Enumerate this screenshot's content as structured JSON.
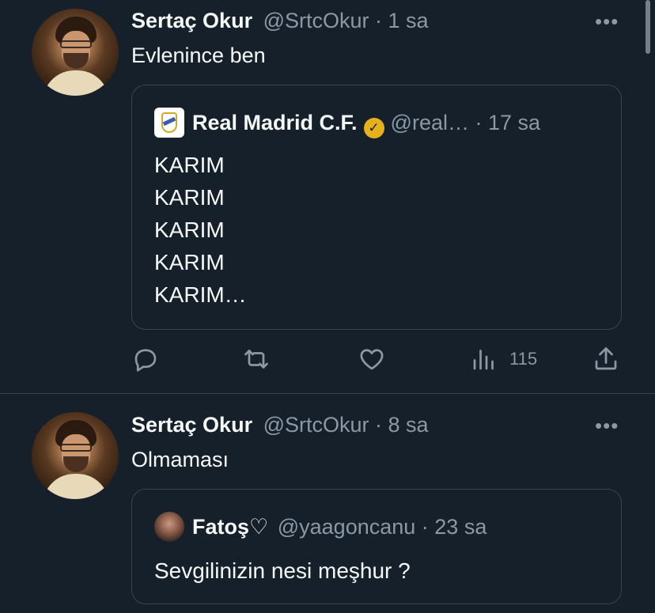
{
  "tweets": [
    {
      "name": "Sertaç Okur",
      "handle": "@SrtcOkur",
      "dot": " · ",
      "time": "1 sa",
      "more": "•••",
      "text": "Evlenince ben",
      "quote": {
        "name": "Real Madrid C.F.",
        "verified_icon": "verified-badge-icon",
        "verified_mark": "✓",
        "handle": "@real…",
        "dot": " · ",
        "time": "17 sa",
        "text": "KARIM\nKARIM\nKARIM\nKARIM\nKARIM…"
      },
      "actions": {
        "reply_icon": "reply-icon",
        "retweet_icon": "retweet-icon",
        "like_icon": "like-icon",
        "views_icon": "views-icon",
        "views_count": "115",
        "share_icon": "share-icon"
      }
    },
    {
      "name": "Sertaç Okur",
      "handle": "@SrtcOkur",
      "dot": " · ",
      "time": "8 sa",
      "more": "•••",
      "text": "Olmaması",
      "quote": {
        "name": "Fatoş♡",
        "handle": "@yaagoncanu",
        "dot": " · ",
        "time": "23 sa",
        "text": "Sevgilinizin nesi meşhur ?"
      }
    }
  ],
  "colors": {
    "background": "#15202b",
    "primary_text": "#f7f9f9",
    "secondary_text": "#8b98a5",
    "border": "#38444d",
    "verified_gold": "#e5b21c"
  }
}
